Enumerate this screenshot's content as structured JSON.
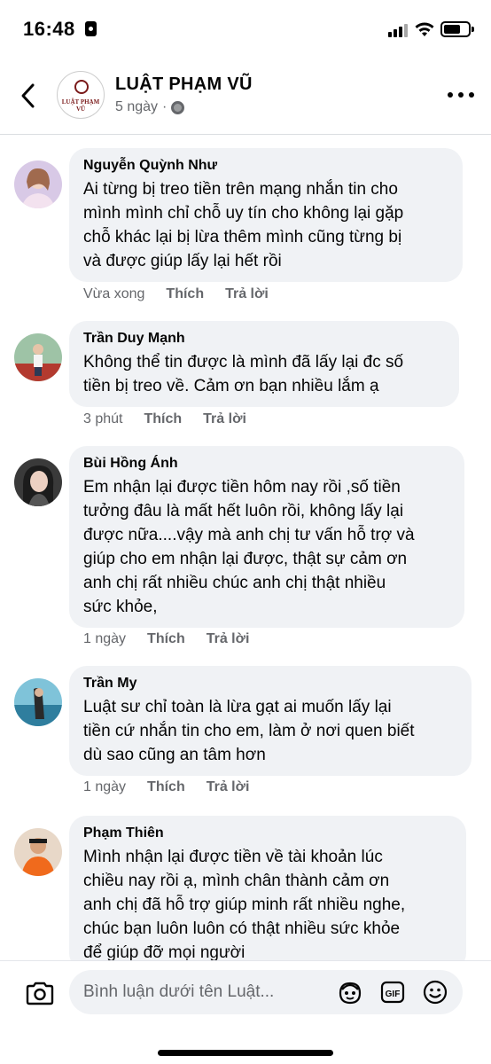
{
  "status_bar": {
    "time": "16:48"
  },
  "header": {
    "page_name": "LUẬT PHẠM VŨ",
    "logo_text": "LUẬT PHẠM VŨ",
    "posted": "5 ngày",
    "separator": "·"
  },
  "comments": [
    {
      "author": "Nguyễn Quỳnh Như",
      "text": "Ai từng bị treo tiền trên mạng nhắn tin cho\nmình mình chỉ chỗ uy tín cho không lại gặp\nchỗ khác lại bị lừa thêm mình cũng từng bị\nvà được giúp lấy lại hết rồi",
      "time": "Vừa xong",
      "like": "Thích",
      "reply": "Trả lời"
    },
    {
      "author": "Trần Duy Mạnh",
      "text": "Không thể tin được là mình đã lấy lại đc số\ntiền bị treo về. Cảm ơn bạn nhiều lắm ạ",
      "time": "3 phút",
      "like": "Thích",
      "reply": "Trả lời"
    },
    {
      "author": "Bùi Hồng Ánh",
      "text": "Em nhận lại được tiền hôm nay rồi ,số tiền\ntưởng đâu là mất hết luôn rồi, không lấy lại\nđược nữa....vậy mà anh chị tư vấn hỗ trợ và\ngiúp cho em nhận lại được, thật sự cảm ơn\nanh chị rất nhiều chúc anh chị thật nhiều\nsức khỏe,",
      "time": "1 ngày",
      "like": "Thích",
      "reply": "Trả lời"
    },
    {
      "author": "Trần My",
      "text": "Luật sư chỉ toàn là lừa gạt ai muốn lấy lại\ntiền cứ nhắn tin cho em, làm ở nơi quen biết\ndù sao cũng an tâm hơn",
      "time": "1 ngày",
      "like": "Thích",
      "reply": "Trả lời"
    },
    {
      "author": "Phạm Thiên",
      "text": "Mình nhận lại được tiền về tài khoản lúc\nchiều nay rồi ạ, mình chân thành cảm ơn\nanh chị đã hỗ trợ giúp minh rất nhiều nghe,\nchúc bạn luôn luôn có thật nhiều sức khỏe\nđể giúp đỡ mọi người",
      "time": "",
      "like": "",
      "reply": ""
    }
  ],
  "composer": {
    "placeholder": "Bình luận dưới tên Luật..."
  },
  "icons": [
    "back-arrow-icon",
    "globe-icon",
    "more-icon",
    "camera-icon",
    "avatar-sticker-icon",
    "gif-icon",
    "emoji-icon",
    "lock-icon",
    "signal-icon",
    "wifi-icon",
    "battery-icon"
  ],
  "colors": {
    "bubble": "#f0f2f5",
    "meta": "#65676b",
    "text": "#050505",
    "divider": "#dadde1"
  }
}
